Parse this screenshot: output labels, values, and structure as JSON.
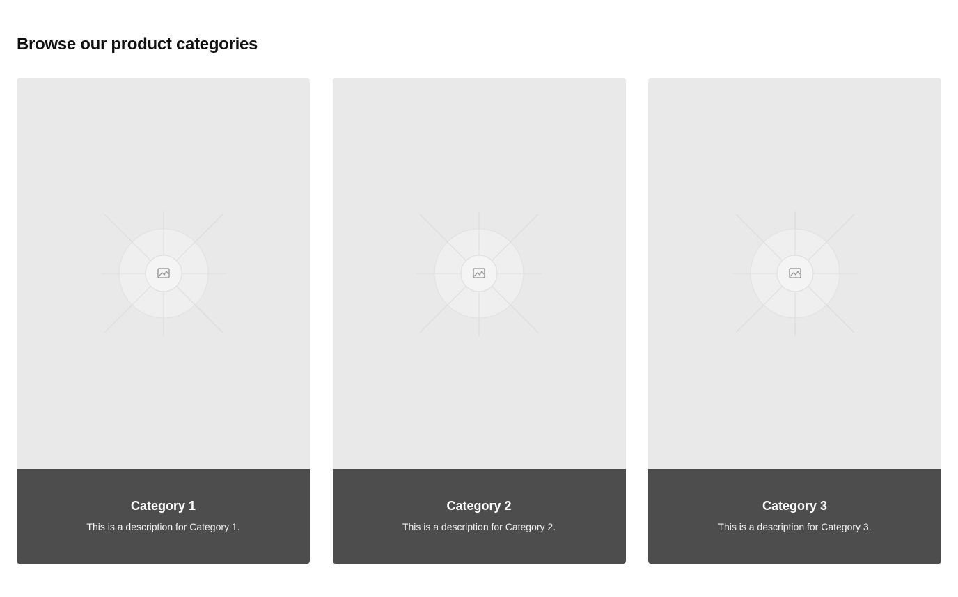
{
  "header": {
    "title": "Browse our product categories"
  },
  "categories": [
    {
      "title": "Category 1",
      "description": "This is a description for Category 1.",
      "image_icon": "image-placeholder-icon"
    },
    {
      "title": "Category 2",
      "description": "This is a description for Category 2.",
      "image_icon": "image-placeholder-icon"
    },
    {
      "title": "Category 3",
      "description": "This is a description for Category 3.",
      "image_icon": "image-placeholder-icon"
    }
  ],
  "colors": {
    "image_placeholder_bg": "#e9e9e9",
    "caption_bg": "#4d4d4d",
    "caption_text": "#ffffff",
    "title_text": "#111111"
  }
}
